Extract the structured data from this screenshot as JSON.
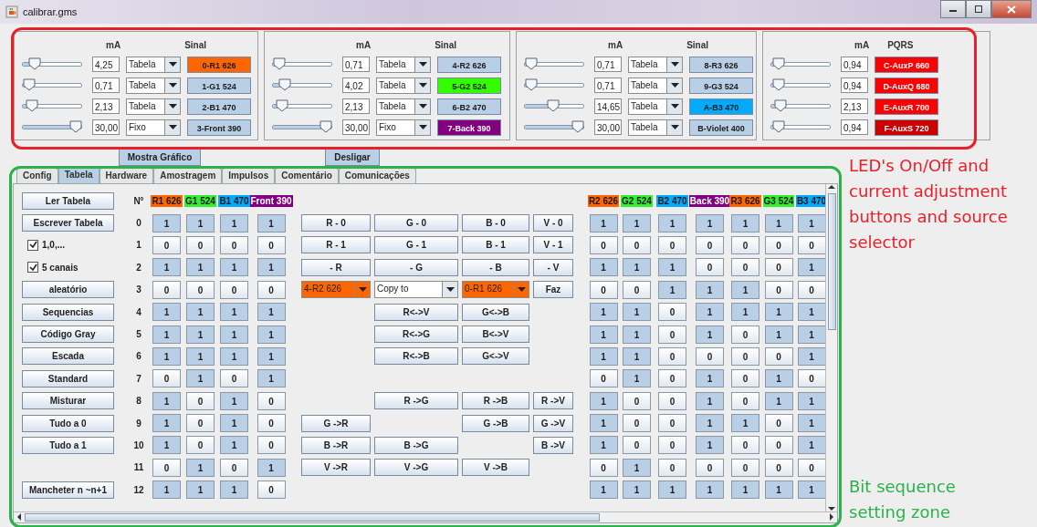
{
  "window": {
    "title": "calibrar.gms"
  },
  "channel_groups": [
    {
      "value_header": "mA",
      "signal_header": "Sinal",
      "channels": [
        {
          "level": 0.14,
          "value": "4,25",
          "source": "Tabela",
          "signal": "0-R1 626",
          "color": "#ff6600"
        },
        {
          "level": 0.02,
          "value": "0,71",
          "source": "Tabela",
          "signal": "1-G1 524",
          "color": "#b8cfe5"
        },
        {
          "level": 0.07,
          "value": "2,13",
          "source": "Tabela",
          "signal": "2-B1 470",
          "color": "#b8cfe5"
        },
        {
          "level": 1.0,
          "value": "30,00",
          "source": "Fixo",
          "signal": "3-Front 390",
          "color": "#b8cfe5"
        }
      ]
    },
    {
      "value_header": "mA",
      "signal_header": "Sinal",
      "channels": [
        {
          "level": 0.02,
          "value": "0,71",
          "source": "Tabela",
          "signal": "4-R2 626",
          "color": "#b8cfe5"
        },
        {
          "level": 0.13,
          "value": "4,02",
          "source": "Tabela",
          "signal": "5-G2 524",
          "color": "#33ff00"
        },
        {
          "level": 0.07,
          "value": "2,13",
          "source": "Tabela",
          "signal": "6-B2 470",
          "color": "#b8cfe5"
        },
        {
          "level": 1.0,
          "value": "30,00",
          "source": "Fixo",
          "signal": "7-Back 390",
          "color": "#800080"
        }
      ]
    },
    {
      "value_header": "mA",
      "signal_header": "Sinal",
      "channels": [
        {
          "level": 0.02,
          "value": "0,71",
          "source": "Tabela",
          "signal": "8-R3 626",
          "color": "#b8cfe5"
        },
        {
          "level": 0.02,
          "value": "0,71",
          "source": "Tabela",
          "signal": "9-G3 524",
          "color": "#b8cfe5"
        },
        {
          "level": 0.49,
          "value": "14,65",
          "source": "Tabela",
          "signal": "A-B3 470",
          "color": "#00aaff"
        },
        {
          "level": 1.0,
          "value": "30,00",
          "source": "Tabela",
          "signal": "B-Violet 400",
          "color": "#b8cfe5"
        }
      ]
    },
    {
      "value_header": "mA",
      "signal_header": "PQRS",
      "channels": [
        {
          "level": 0.03,
          "value": "0,94",
          "signal": "C-AuxP 660",
          "color": "#ff0000"
        },
        {
          "level": 0.03,
          "value": "0,94",
          "signal": "D-AuxQ 680",
          "color": "#ff0000"
        },
        {
          "level": 0.07,
          "value": "2,13",
          "signal": "E-AuxR 700",
          "color": "#ff0000"
        },
        {
          "level": 0.03,
          "value": "0,94",
          "signal": "F-AuxS 720",
          "color": "#cc0000"
        }
      ]
    }
  ],
  "buttons": [
    "Mostra Gráfico",
    "Desligar"
  ],
  "tabs": [
    {
      "label": "Config",
      "selected": false
    },
    {
      "label": "Tabela",
      "selected": true
    },
    {
      "label": "Hardware",
      "selected": false
    },
    {
      "label": "Amostragem",
      "selected": false
    },
    {
      "label": "Impulsos",
      "selected": false
    },
    {
      "label": "Comentário",
      "selected": false
    },
    {
      "label": "Comunicações",
      "selected": false
    }
  ],
  "table": {
    "header_button": "Ler Tabela",
    "number_header": "N°",
    "left_columns": [
      {
        "label": "R1 626",
        "color": "#ff6600"
      },
      {
        "label": "G1 524",
        "color": "#33ee33"
      },
      {
        "label": "B1 470",
        "color": "#00aaff"
      },
      {
        "label": "Front 390",
        "color": "#800080"
      }
    ],
    "right_columns": [
      {
        "label": "R2 626",
        "color": "#ff6600"
      },
      {
        "label": "G2 524",
        "color": "#33ee33"
      },
      {
        "label": "B2 470",
        "color": "#00aaff"
      },
      {
        "label": "Back 390",
        "color": "#800080"
      },
      {
        "label": "R3 626",
        "color": "#ff6600"
      },
      {
        "label": "G3 524",
        "color": "#33ee33"
      },
      {
        "label": "B3 470",
        "color": "#00aaff"
      }
    ],
    "rows": [
      {
        "n": "0",
        "control": {
          "kind": "button",
          "label": "Escrever Tabela"
        },
        "left_bits": [
          {
            "value": "1",
            "on": true
          },
          {
            "value": "1",
            "on": true
          },
          {
            "value": "1",
            "on": true
          },
          {
            "value": "1",
            "on": true
          }
        ],
        "actions": [
          {
            "kind": "button",
            "label": "R - 0"
          },
          {
            "kind": "button",
            "label": "G - 0"
          },
          {
            "kind": "button",
            "label": "B - 0"
          },
          {
            "kind": "button",
            "label": "V - 0"
          }
        ],
        "right_bits": [
          {
            "value": "1",
            "on": true
          },
          {
            "value": "1",
            "on": true
          },
          {
            "value": "1",
            "on": true
          },
          {
            "value": "1",
            "on": true
          },
          {
            "value": "1",
            "on": true
          },
          {
            "value": "1",
            "on": true
          },
          {
            "value": "1",
            "on": true
          }
        ]
      },
      {
        "n": "1",
        "control": {
          "kind": "checkbox",
          "label": "1,0,...",
          "checked": true
        },
        "left_bits": [
          {
            "value": "0",
            "on": false
          },
          {
            "value": "0",
            "on": false
          },
          {
            "value": "0",
            "on": false
          },
          {
            "value": "0",
            "on": false
          }
        ],
        "actions": [
          {
            "kind": "button",
            "label": "R - 1"
          },
          {
            "kind": "button",
            "label": "G - 1"
          },
          {
            "kind": "button",
            "label": "B - 1"
          },
          {
            "kind": "button",
            "label": "V - 1"
          }
        ],
        "right_bits": [
          {
            "value": "0",
            "on": false
          },
          {
            "value": "0",
            "on": false
          },
          {
            "value": "0",
            "on": false
          },
          {
            "value": "0",
            "on": false
          },
          {
            "value": "0",
            "on": false
          },
          {
            "value": "0",
            "on": false
          },
          {
            "value": "0",
            "on": false
          }
        ]
      },
      {
        "n": "2",
        "control": {
          "kind": "checkbox",
          "label": "5 canais",
          "checked": true
        },
        "left_bits": [
          {
            "value": "1",
            "on": true
          },
          {
            "value": "1",
            "on": true
          },
          {
            "value": "1",
            "on": true
          },
          {
            "value": "1",
            "on": true
          }
        ],
        "actions": [
          {
            "kind": "button",
            "label": "- R"
          },
          {
            "kind": "button",
            "label": "- G"
          },
          {
            "kind": "button",
            "label": "- B"
          },
          {
            "kind": "button",
            "label": "- V"
          }
        ],
        "right_bits": [
          {
            "value": "1",
            "on": true
          },
          {
            "value": "1",
            "on": true
          },
          {
            "value": "1",
            "on": true
          },
          {
            "value": "0",
            "on": false
          },
          {
            "value": "0",
            "on": false
          },
          {
            "value": "0",
            "on": false
          },
          {
            "value": "1",
            "on": true
          }
        ]
      },
      {
        "n": "3",
        "control": {
          "kind": "button",
          "label": "aleatório"
        },
        "left_bits": [
          {
            "value": "0",
            "on": false
          },
          {
            "value": "0",
            "on": false
          },
          {
            "value": "0",
            "on": false
          },
          {
            "value": "0",
            "on": false
          }
        ],
        "actions": [
          {
            "kind": "dropdown",
            "label": "4-R2 626",
            "color": "#ff6600"
          },
          {
            "kind": "dropdown",
            "label": "Copy to"
          },
          {
            "kind": "dropdown",
            "label": "0-R1 626",
            "color": "#ff6600"
          },
          {
            "kind": "button",
            "label": "Faz"
          }
        ],
        "right_bits": [
          {
            "value": "0",
            "on": false
          },
          {
            "value": "0",
            "on": false
          },
          {
            "value": "1",
            "on": true
          },
          {
            "value": "1",
            "on": true
          },
          {
            "value": "1",
            "on": true
          },
          {
            "value": "0",
            "on": false
          },
          {
            "value": "0",
            "on": false
          }
        ]
      },
      {
        "n": "4",
        "control": {
          "kind": "button",
          "label": "Sequencias"
        },
        "left_bits": [
          {
            "value": "1",
            "on": true
          },
          {
            "value": "1",
            "on": true
          },
          {
            "value": "1",
            "on": true
          },
          {
            "value": "1",
            "on": true
          }
        ],
        "actions": [
          {
            "kind": "empty"
          },
          {
            "kind": "button",
            "label": "R<->V"
          },
          {
            "kind": "button",
            "label": "G<->B"
          },
          {
            "kind": "empty"
          }
        ],
        "right_bits": [
          {
            "value": "1",
            "on": true
          },
          {
            "value": "1",
            "on": true
          },
          {
            "value": "0",
            "on": false
          },
          {
            "value": "1",
            "on": true
          },
          {
            "value": "1",
            "on": true
          },
          {
            "value": "1",
            "on": true
          },
          {
            "value": "1",
            "on": true
          }
        ]
      },
      {
        "n": "5",
        "control": {
          "kind": "button",
          "label": "Código Gray"
        },
        "left_bits": [
          {
            "value": "1",
            "on": true
          },
          {
            "value": "1",
            "on": true
          },
          {
            "value": "1",
            "on": true
          },
          {
            "value": "1",
            "on": true
          }
        ],
        "actions": [
          {
            "kind": "empty"
          },
          {
            "kind": "button",
            "label": "R<->G"
          },
          {
            "kind": "button",
            "label": "B<->V"
          },
          {
            "kind": "empty"
          }
        ],
        "right_bits": [
          {
            "value": "1",
            "on": true
          },
          {
            "value": "1",
            "on": true
          },
          {
            "value": "0",
            "on": false
          },
          {
            "value": "1",
            "on": true
          },
          {
            "value": "0",
            "on": false
          },
          {
            "value": "1",
            "on": true
          },
          {
            "value": "1",
            "on": true
          }
        ]
      },
      {
        "n": "6",
        "control": {
          "kind": "button",
          "label": "Escada"
        },
        "left_bits": [
          {
            "value": "1",
            "on": true
          },
          {
            "value": "1",
            "on": true
          },
          {
            "value": "1",
            "on": true
          },
          {
            "value": "1",
            "on": true
          }
        ],
        "actions": [
          {
            "kind": "empty"
          },
          {
            "kind": "button",
            "label": "R<->B"
          },
          {
            "kind": "button",
            "label": "G<->V"
          },
          {
            "kind": "empty"
          }
        ],
        "right_bits": [
          {
            "value": "1",
            "on": true
          },
          {
            "value": "1",
            "on": true
          },
          {
            "value": "0",
            "on": false
          },
          {
            "value": "0",
            "on": false
          },
          {
            "value": "0",
            "on": false
          },
          {
            "value": "0",
            "on": false
          },
          {
            "value": "1",
            "on": true
          }
        ]
      },
      {
        "n": "7",
        "control": {
          "kind": "button",
          "label": "Standard"
        },
        "left_bits": [
          {
            "value": "0",
            "on": false
          },
          {
            "value": "1",
            "on": true
          },
          {
            "value": "0",
            "on": false
          },
          {
            "value": "1",
            "on": true
          }
        ],
        "actions": [],
        "right_bits": [
          {
            "value": "0",
            "on": false
          },
          {
            "value": "1",
            "on": true
          },
          {
            "value": "0",
            "on": false
          },
          {
            "value": "1",
            "on": true
          },
          {
            "value": "0",
            "on": false
          },
          {
            "value": "1",
            "on": true
          },
          {
            "value": "0",
            "on": false
          }
        ]
      },
      {
        "n": "8",
        "control": {
          "kind": "button",
          "label": "Misturar"
        },
        "left_bits": [
          {
            "value": "1",
            "on": true
          },
          {
            "value": "0",
            "on": false
          },
          {
            "value": "1",
            "on": true
          },
          {
            "value": "0",
            "on": false
          }
        ],
        "actions": [
          {
            "kind": "empty"
          },
          {
            "kind": "button",
            "label": "R ->G"
          },
          {
            "kind": "button",
            "label": "R ->B"
          },
          {
            "kind": "button",
            "label": "R ->V"
          }
        ],
        "right_bits": [
          {
            "value": "1",
            "on": true
          },
          {
            "value": "0",
            "on": false
          },
          {
            "value": "0",
            "on": false
          },
          {
            "value": "1",
            "on": true
          },
          {
            "value": "0",
            "on": false
          },
          {
            "value": "1",
            "on": true
          },
          {
            "value": "1",
            "on": true
          }
        ]
      },
      {
        "n": "9",
        "control": {
          "kind": "button",
          "label": "Tudo a 0"
        },
        "left_bits": [
          {
            "value": "1",
            "on": true
          },
          {
            "value": "0",
            "on": false
          },
          {
            "value": "1",
            "on": true
          },
          {
            "value": "0",
            "on": false
          }
        ],
        "actions": [
          {
            "kind": "button",
            "label": "G ->R"
          },
          {
            "kind": "empty"
          },
          {
            "kind": "button",
            "label": "G ->B"
          },
          {
            "kind": "button",
            "label": "G ->V"
          }
        ],
        "right_bits": [
          {
            "value": "1",
            "on": true
          },
          {
            "value": "0",
            "on": false
          },
          {
            "value": "0",
            "on": false
          },
          {
            "value": "1",
            "on": true
          },
          {
            "value": "1",
            "on": true
          },
          {
            "value": "0",
            "on": false
          },
          {
            "value": "1",
            "on": true
          }
        ]
      },
      {
        "n": "10",
        "control": {
          "kind": "button",
          "label": "Tudo a 1"
        },
        "left_bits": [
          {
            "value": "1",
            "on": true
          },
          {
            "value": "0",
            "on": false
          },
          {
            "value": "1",
            "on": true
          },
          {
            "value": "0",
            "on": false
          }
        ],
        "actions": [
          {
            "kind": "button",
            "label": "B ->R"
          },
          {
            "kind": "button",
            "label": "B ->G"
          },
          {
            "kind": "empty"
          },
          {
            "kind": "button",
            "label": "B ->V"
          }
        ],
        "right_bits": [
          {
            "value": "1",
            "on": true
          },
          {
            "value": "0",
            "on": false
          },
          {
            "value": "0",
            "on": false
          },
          {
            "value": "1",
            "on": true
          },
          {
            "value": "0",
            "on": false
          },
          {
            "value": "0",
            "on": false
          },
          {
            "value": "1",
            "on": true
          }
        ]
      },
      {
        "n": "11",
        "left_bits": [
          {
            "value": "0",
            "on": false
          },
          {
            "value": "1",
            "on": true
          },
          {
            "value": "0",
            "on": false
          },
          {
            "value": "1",
            "on": true
          }
        ],
        "actions": [
          {
            "kind": "button",
            "label": "V ->R"
          },
          {
            "kind": "button",
            "label": "V ->G"
          },
          {
            "kind": "button",
            "label": "V ->B"
          },
          {
            "kind": "empty"
          }
        ],
        "right_bits": [
          {
            "value": "0",
            "on": false
          },
          {
            "value": "1",
            "on": true
          },
          {
            "value": "0",
            "on": false
          },
          {
            "value": "0",
            "on": false
          },
          {
            "value": "0",
            "on": false
          },
          {
            "value": "0",
            "on": false
          },
          {
            "value": "0",
            "on": false
          }
        ]
      },
      {
        "n": "12",
        "control": {
          "kind": "button",
          "label": "Mancheter n ~n+1"
        },
        "left_bits": [
          {
            "value": "1",
            "on": true
          },
          {
            "value": "1",
            "on": true
          },
          {
            "value": "1",
            "on": true
          },
          {
            "value": "0",
            "on": false
          }
        ],
        "actions": [],
        "right_bits": [
          {
            "value": "1",
            "on": true
          },
          {
            "value": "1",
            "on": true
          },
          {
            "value": "1",
            "on": true
          },
          {
            "value": "1",
            "on": true
          },
          {
            "value": "1",
            "on": true
          },
          {
            "value": "1",
            "on": true
          },
          {
            "value": "1",
            "on": true
          }
        ]
      }
    ]
  },
  "annotations": [
    {
      "text": "LED's On/Off and current adjustment buttons and source selector",
      "color": "#e8202a"
    },
    {
      "text": "Bit sequence setting zone",
      "color": "#2bb24c"
    }
  ]
}
